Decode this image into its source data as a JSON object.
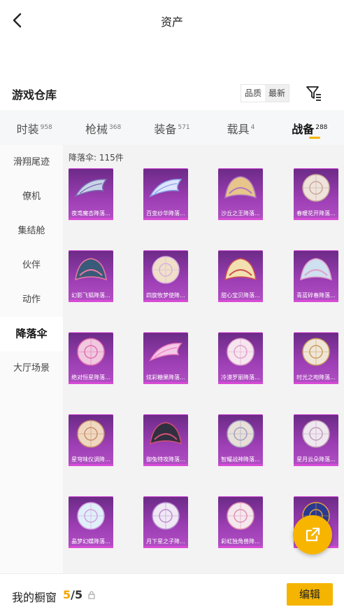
{
  "header": {
    "title": "资产"
  },
  "section": {
    "title": "游戏仓库",
    "sort_options": [
      "品质",
      "最新"
    ],
    "active_sort": 1
  },
  "tabs": [
    {
      "label": "时装",
      "count": "958"
    },
    {
      "label": "枪械",
      "count": "368"
    },
    {
      "label": "装备",
      "count": "571"
    },
    {
      "label": "载具",
      "count": "4"
    },
    {
      "label": "战备",
      "count": "288",
      "active": true
    }
  ],
  "sidebar": {
    "items": [
      {
        "label": "滑翔尾迹"
      },
      {
        "label": "僚机"
      },
      {
        "label": "集结舱"
      },
      {
        "label": "伙伴"
      },
      {
        "label": "动作"
      },
      {
        "label": "降落伞",
        "active": true
      },
      {
        "label": "大厅场景"
      }
    ]
  },
  "content": {
    "count_label": "降落伞: 115件",
    "items": [
      {
        "name": "夜鸢魔杏降落...",
        "art": "wing",
        "c1": "#c8d3e8",
        "c2": "#7a6bb0"
      },
      {
        "name": "百变纱华降落...",
        "art": "wing",
        "c1": "#dfe6ff",
        "c2": "#8aa0e8"
      },
      {
        "name": "沙丘之王降落...",
        "art": "dome",
        "c1": "#e8c58a",
        "c2": "#b07ac0"
      },
      {
        "name": "春暖花开降落...",
        "art": "round",
        "c1": "#efe4dc",
        "c2": "#c8a89a"
      },
      {
        "name": "幻影飞狐降落...",
        "art": "dome",
        "c1": "#3a5a7a",
        "c2": "#e87aa0"
      },
      {
        "name": "四旋牧梦使降...",
        "art": "round",
        "c1": "#f0e0c8",
        "c2": "#d8b0e0"
      },
      {
        "name": "甜心宝贝降落...",
        "art": "dome",
        "c1": "#f2e0b0",
        "c2": "#d05050"
      },
      {
        "name": "青蓝碎春降落...",
        "art": "dome",
        "c1": "#cfe0f0",
        "c2": "#e0a0c8"
      },
      {
        "name": "绝对恒星降落...",
        "art": "round",
        "c1": "#f0c8e0",
        "c2": "#e070b0"
      },
      {
        "name": "炫彩糖果降落...",
        "art": "wing",
        "c1": "#f4c8e8",
        "c2": "#f080c0"
      },
      {
        "name": "冷漠罗丽降落...",
        "art": "round",
        "c1": "#f6e6f0",
        "c2": "#e0a0c8"
      },
      {
        "name": "时光之吻降落...",
        "art": "round",
        "c1": "#f0e6d8",
        "c2": "#c8a060"
      },
      {
        "name": "星穹味仪调降...",
        "art": "round",
        "c1": "#f0d8c0",
        "c2": "#c89070"
      },
      {
        "name": "御兔特攻降落...",
        "art": "dome",
        "c1": "#303040",
        "c2": "#d05070"
      },
      {
        "name": "智耀战神降落...",
        "art": "round",
        "c1": "#e8e0d8",
        "c2": "#a0a0c0"
      },
      {
        "name": "星月云朵降落...",
        "art": "round",
        "c1": "#f0e8f0",
        "c2": "#c0a0b8"
      },
      {
        "name": "晶梦幻蝶降落...",
        "art": "round",
        "c1": "#e0f0f8",
        "c2": "#d0a0e0"
      },
      {
        "name": "月下星之子降...",
        "art": "round",
        "c1": "#f0e8f4",
        "c2": "#b890d0"
      },
      {
        "name": "彩虹独角兽降...",
        "art": "round",
        "c1": "#f4e8ee",
        "c2": "#e090b0"
      },
      {
        "name": "",
        "art": "round",
        "c1": "#2a3a90",
        "c2": "#e0a040"
      }
    ]
  },
  "fab": {
    "icon": "share-external-icon"
  },
  "bottom": {
    "label": "我的橱窗",
    "current": "5",
    "total": "/5",
    "edit_label": "编辑"
  },
  "colors": {
    "accent": "#f5b400",
    "card_bg": "#9e3fb5"
  }
}
